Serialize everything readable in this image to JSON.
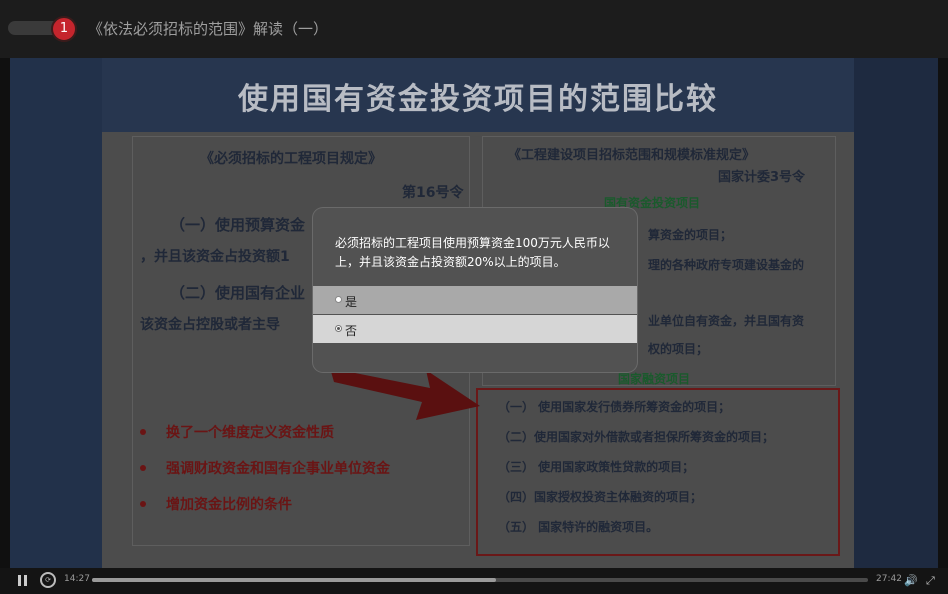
{
  "header": {
    "badge_number": "1",
    "title": "《依法必须招标的范围》解读（一）"
  },
  "slide": {
    "title": "使用国有资金投资项目的范围比较",
    "left": {
      "heading": "《必须招标的工程项目规定》",
      "order": "第16号令",
      "line1": "（一）使用预算资金",
      "line2": "，并且该资金占投资额1",
      "line3": "（二）使用国有企业",
      "line4": "该资金占控股或者主导",
      "bullets": [
        "换了一个维度定义资金性质",
        "强调财政资金和国有企事业单位资金",
        "增加资金比例的条件"
      ]
    },
    "right": {
      "heading": "《工程建设项目招标范围和规模标准规定》",
      "order": "国家计委3号令",
      "sub1": "国有资金投资项目",
      "r1": "算资金的项目；",
      "r2": "理的各种政府专项建设基金的",
      "r3": "业单位自有资金，并且国有资",
      "r4": "权的项目；",
      "sub2": "国家融资项目",
      "items": [
        "（一） 使用国家发行债券所筹资金的项目；",
        "（二）使用国家对外借款或者担保所筹资金的项目；",
        "（三） 使用国家政策性贷款的项目；",
        "（四）国家授权投资主体融资的项目；",
        "（五） 国家特许的融资项目。"
      ]
    }
  },
  "quiz": {
    "question": "必须招标的工程项目使用预算资金100万元人民币以上，并且该资金占投资额20%以上的项目。",
    "options": [
      {
        "label": "是",
        "selected": false
      },
      {
        "label": "否",
        "selected": true
      }
    ]
  },
  "player": {
    "current_time": "14:27",
    "total_time": "27:42",
    "progress": 0.52
  }
}
